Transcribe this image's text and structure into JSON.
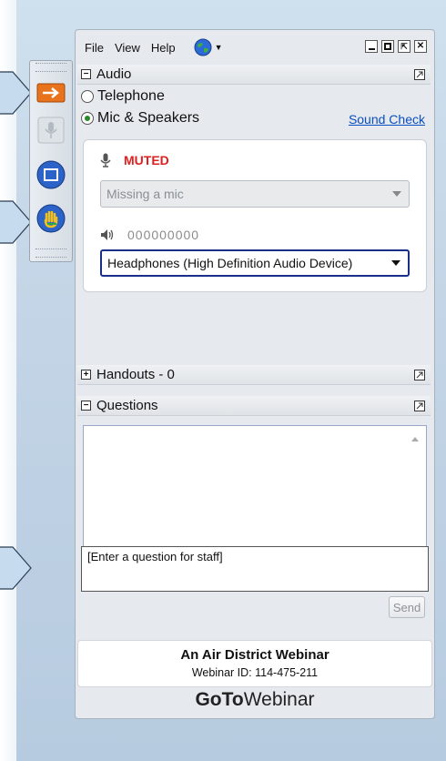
{
  "menu": {
    "file": "File",
    "view": "View",
    "help": "Help"
  },
  "audio": {
    "title": "Audio",
    "telephone": "Telephone",
    "mic_speakers": "Mic & Speakers",
    "sound_check": "Sound Check",
    "muted": "MUTED",
    "mic_placeholder": "Missing a mic",
    "level_text": "000000000",
    "speaker_device": "Headphones (High Definition Audio Device)"
  },
  "handouts": {
    "title": "Handouts - 0"
  },
  "questions": {
    "title": "Questions",
    "placeholder": "[Enter a question for staff]",
    "send": "Send"
  },
  "footer": {
    "title": "An Air District Webinar",
    "webinar_id": "Webinar ID: 114-475-211"
  },
  "brand": {
    "bold": "GoTo",
    "light": "Webinar"
  },
  "colors": {
    "muted": "#e02020",
    "link": "#0a4fc0",
    "accent_orange": "#e8731c"
  },
  "icons": {
    "globe": "globe-icon",
    "mic": "mic-icon",
    "speaker": "speaker-icon"
  }
}
